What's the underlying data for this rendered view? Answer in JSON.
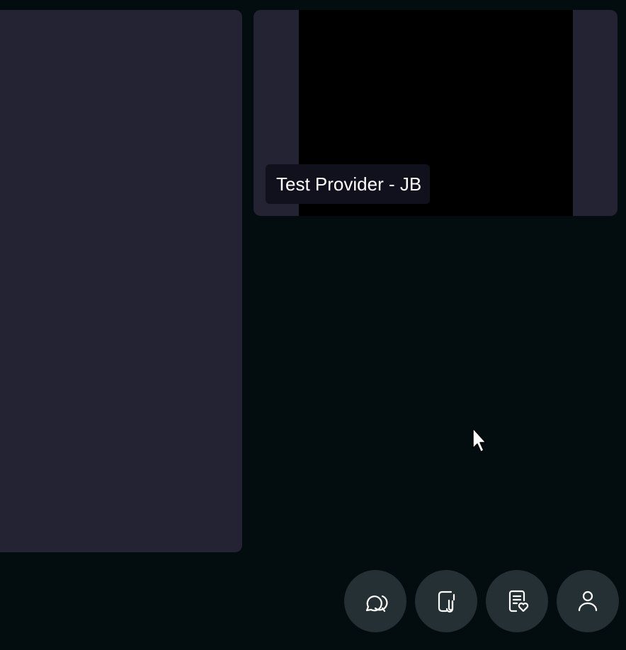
{
  "participants": {
    "self": {
      "name": "Test Provider - JB"
    }
  },
  "toolbar": {
    "buttons": [
      {
        "id": "chat",
        "icon": "chat-bubbles-icon"
      },
      {
        "id": "files",
        "icon": "paperclip-document-icon"
      },
      {
        "id": "notes",
        "icon": "document-heart-icon"
      },
      {
        "id": "participants",
        "icon": "person-icon"
      }
    ]
  },
  "colors": {
    "background": "#030c0f",
    "tile": "#232333",
    "video_black": "#000000",
    "name_label_bg": "#11111e",
    "toolbar_button": "#243033",
    "icon": "#ffffff"
  }
}
